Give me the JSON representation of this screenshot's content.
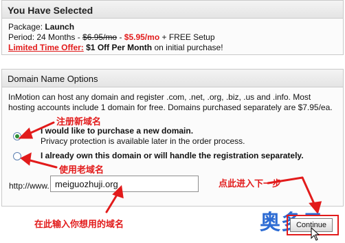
{
  "selected": {
    "title": "You Have Selected",
    "package_label": "Package: ",
    "package_value": "Launch",
    "period_label": "Period: 24 Months - ",
    "old_price": "$6.95/mo",
    "dash": " - ",
    "new_price": "$5.95/mo",
    "period_suffix": " + FREE Setup",
    "offer_label": "Limited Time Offer:",
    "offer_bold": " $1 Off Per Month",
    "offer_suffix": " on initial purchase!"
  },
  "domain": {
    "title": "Domain Name Options",
    "description": "InMotion can host any domain and register .com, .net, .org, .biz, .us and .info. Most hosting accounts include 1 domain for free. Domains purchased separately are $7.95/ea.",
    "options": [
      {
        "label": "I would like to purchase a new domain.",
        "sublabel": "Privacy protection is available later in the order process.",
        "checked": true
      },
      {
        "label": "I already own this domain or will handle the registration separately.",
        "sublabel": "",
        "checked": false
      }
    ],
    "url_prefix": "http://www.",
    "url_value": "meiguozhuji.org"
  },
  "annotations": {
    "new_domain": "注册新域名",
    "old_domain": "使用老域名",
    "next_step": "点此进入下一步",
    "enter_domain": "在此输入你想用的域名",
    "color": "#e21b1b"
  },
  "continue_label": "Continue",
  "watermark": "奥多云"
}
